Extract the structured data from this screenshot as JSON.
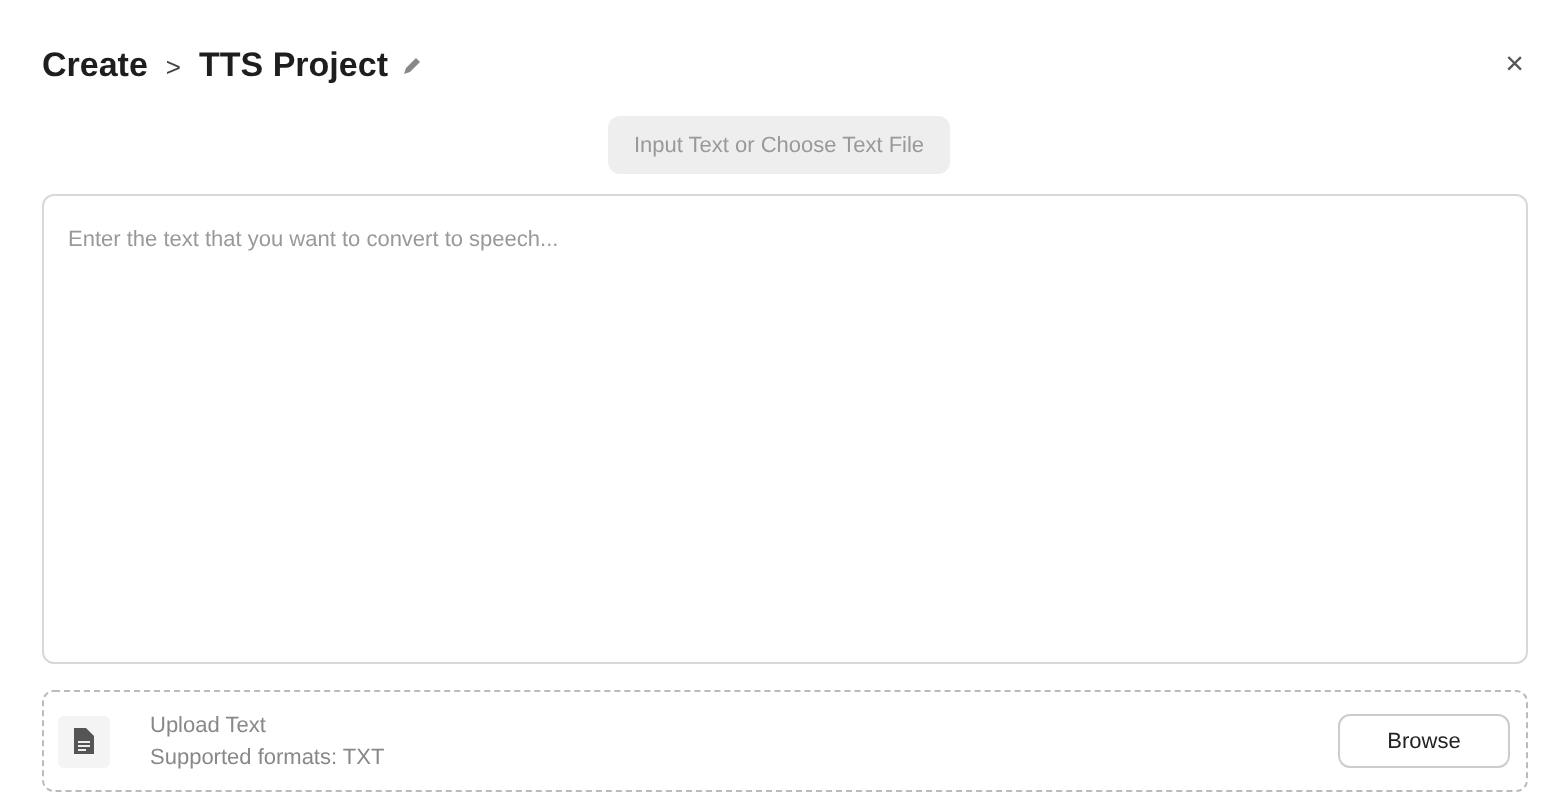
{
  "breadcrumb": {
    "parent": "Create",
    "separator": ">",
    "current": "TTS Project"
  },
  "close": "×",
  "mode_button": {
    "label": "Input Text or Choose Text File",
    "disabled": true
  },
  "text_input": {
    "placeholder": "Enter the text that you want to convert to speech..."
  },
  "upload": {
    "title": "Upload Text",
    "formats": "Supported formats: TXT",
    "button": "Browse"
  }
}
